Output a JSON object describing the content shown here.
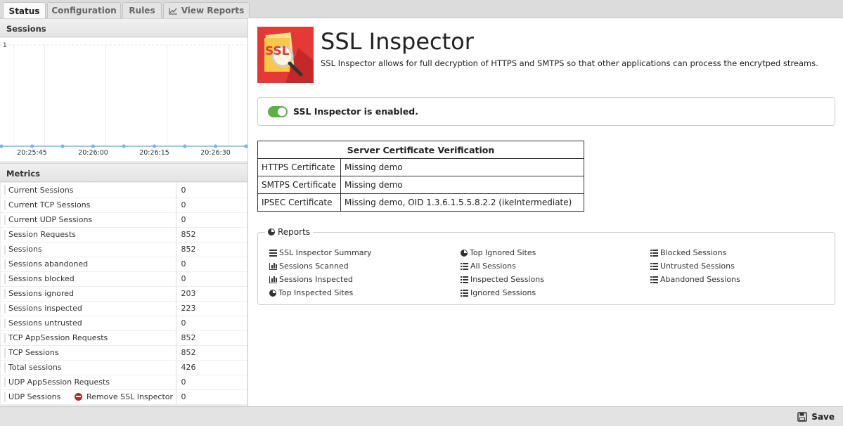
{
  "tabs": [
    {
      "label": "Status",
      "active": true
    },
    {
      "label": "Configuration",
      "active": false
    },
    {
      "label": "Rules",
      "active": false
    },
    {
      "label": "View Reports",
      "active": false
    }
  ],
  "sessions_panel": {
    "title": "Sessions",
    "chart_data": {
      "type": "line",
      "x": [
        "20:25:40",
        "20:25:45",
        "20:25:52",
        "20:26:00",
        "20:26:07",
        "20:26:15",
        "20:26:22",
        "20:26:30",
        "20:26:37"
      ],
      "series": [
        {
          "values": [
            0,
            0,
            0,
            0,
            0,
            0,
            0,
            0,
            0
          ]
        }
      ],
      "tick_labels": [
        "20:25:45",
        "20:26:00",
        "20:26:15",
        "20:26:30"
      ],
      "y_tick_label": "1",
      "ylim": [
        0,
        1
      ],
      "grid": true,
      "line_color": "#7cb5ec"
    }
  },
  "metrics_panel": {
    "title": "Metrics",
    "rows": [
      {
        "name": "Current Sessions",
        "value": "0"
      },
      {
        "name": "Current TCP Sessions",
        "value": "0"
      },
      {
        "name": "Current UDP Sessions",
        "value": "0"
      },
      {
        "name": "Session Requests",
        "value": "852"
      },
      {
        "name": "Sessions",
        "value": "852"
      },
      {
        "name": "Sessions abandoned",
        "value": "0"
      },
      {
        "name": "Sessions blocked",
        "value": "0"
      },
      {
        "name": "Sessions ignored",
        "value": "203"
      },
      {
        "name": "Sessions inspected",
        "value": "223"
      },
      {
        "name": "Sessions untrusted",
        "value": "0"
      },
      {
        "name": "TCP AppSession Requests",
        "value": "852"
      },
      {
        "name": "TCP Sessions",
        "value": "852"
      },
      {
        "name": "Total sessions",
        "value": "426"
      },
      {
        "name": "UDP AppSession Requests",
        "value": "0"
      },
      {
        "name": "UDP Sessions",
        "value": "0"
      }
    ],
    "remove_label": "Remove SSL Inspector"
  },
  "app": {
    "logo_text": "SSL",
    "title": "SSL Inspector",
    "description": "SSL Inspector allows for full decryption of HTTPS and SMTPS so that other applications can process the encrytped streams.",
    "status_text": "SSL Inspector is enabled.",
    "enabled": true
  },
  "certificates": {
    "header": "Server Certificate Verification",
    "rows": [
      {
        "name": "HTTPS Certificate",
        "value": "Missing demo"
      },
      {
        "name": "SMTPS Certificate",
        "value": "Missing demo"
      },
      {
        "name": "IPSEC Certificate",
        "value": "Missing demo, OID 1.3.6.1.5.5.8.2.2 (ikeIntermediate)"
      }
    ]
  },
  "reports": {
    "title": "Reports",
    "columns": [
      [
        {
          "label": "SSL Inspector Summary",
          "icon": "list-icon"
        },
        {
          "label": "Sessions Scanned",
          "icon": "bar-chart-icon"
        },
        {
          "label": "Sessions Inspected",
          "icon": "bar-chart-icon"
        },
        {
          "label": "Top Inspected Sites",
          "icon": "pie-chart-icon"
        }
      ],
      [
        {
          "label": "Top Ignored Sites",
          "icon": "pie-chart-icon"
        },
        {
          "label": "All Sessions",
          "icon": "list-bullet-icon"
        },
        {
          "label": "Inspected Sessions",
          "icon": "list-bullet-icon"
        },
        {
          "label": "Ignored Sessions",
          "icon": "list-bullet-icon"
        }
      ],
      [
        {
          "label": "Blocked Sessions",
          "icon": "list-bullet-icon"
        },
        {
          "label": "Untrusted Sessions",
          "icon": "list-bullet-icon"
        },
        {
          "label": "Abandoned Sessions",
          "icon": "list-bullet-icon"
        }
      ]
    ]
  },
  "footer": {
    "save_label": "Save"
  },
  "colors": {
    "accent_green": "#5ab146",
    "danger_red": "#cc1f1f",
    "logo_red": "#e53935",
    "logo_yellow": "#f7c948"
  }
}
